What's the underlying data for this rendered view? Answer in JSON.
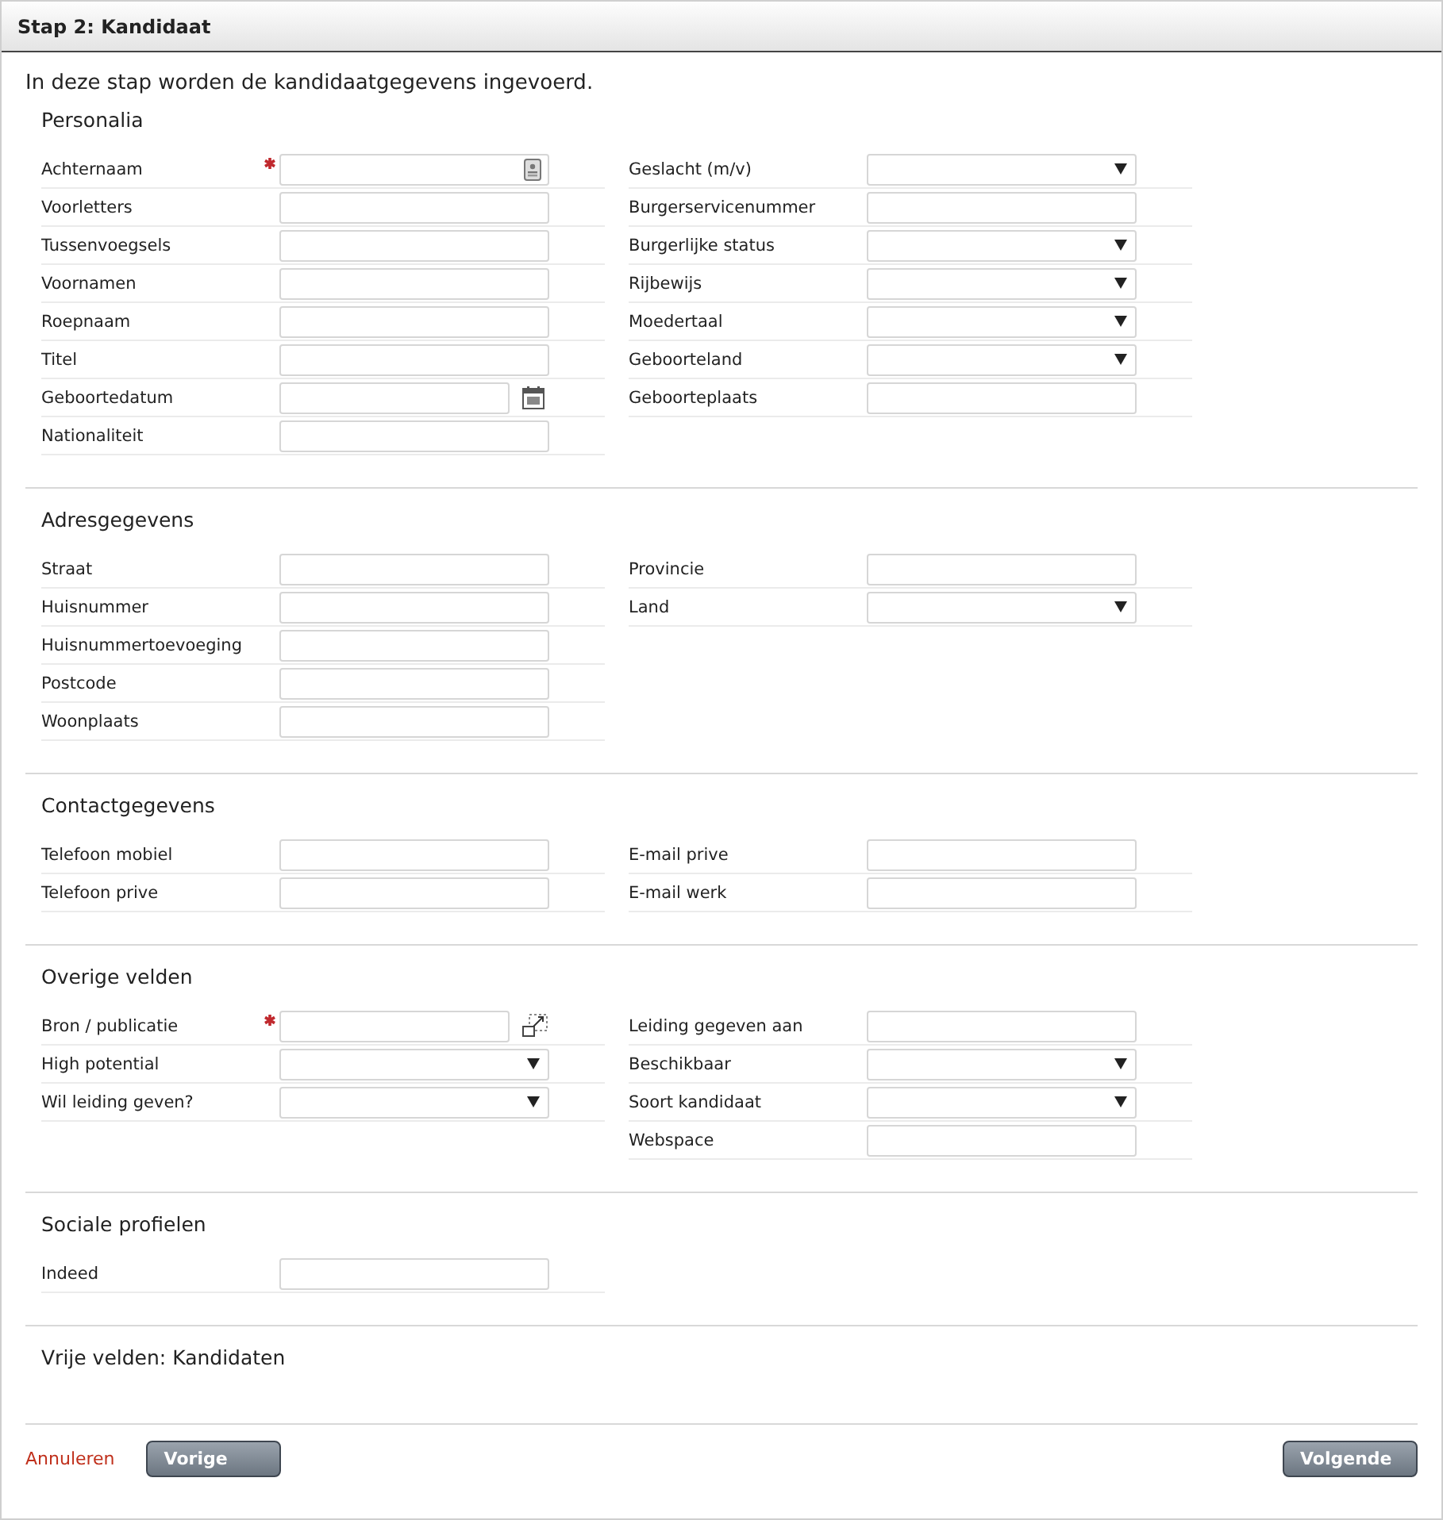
{
  "header": {
    "title": "Stap 2: Kandidaat"
  },
  "intro": "In deze stap worden de kandidaatgegevens ingevoerd.",
  "sections": [
    {
      "title": "Personalia",
      "left": [
        {
          "label": "Achternaam",
          "kind": "lookup",
          "required": true
        },
        {
          "label": "Voorletters",
          "kind": "text",
          "required": false
        },
        {
          "label": "Tussenvoegsels",
          "kind": "text",
          "required": false
        },
        {
          "label": "Voornamen",
          "kind": "text",
          "required": false
        },
        {
          "label": "Roepnaam",
          "kind": "text",
          "required": false
        },
        {
          "label": "Titel",
          "kind": "text",
          "required": false
        },
        {
          "label": "Geboortedatum",
          "kind": "date",
          "required": false
        },
        {
          "label": "Nationaliteit",
          "kind": "text",
          "required": false
        }
      ],
      "right": [
        {
          "label": "Geslacht (m/v)",
          "kind": "select",
          "required": false
        },
        {
          "label": "Burgerservicenummer",
          "kind": "text",
          "required": false
        },
        {
          "label": "Burgerlijke status",
          "kind": "select",
          "required": false
        },
        {
          "label": "Rijbewijs",
          "kind": "select",
          "required": false
        },
        {
          "label": "Moedertaal",
          "kind": "select",
          "required": false
        },
        {
          "label": "Geboorteland",
          "kind": "select",
          "required": false
        },
        {
          "label": "Geboorteplaats",
          "kind": "text",
          "required": false
        }
      ]
    },
    {
      "title": "Adresgegevens",
      "left": [
        {
          "label": "Straat",
          "kind": "text",
          "required": false
        },
        {
          "label": "Huisnummer",
          "kind": "text",
          "required": false
        },
        {
          "label": "Huisnummertoevoeging",
          "kind": "text",
          "required": false
        },
        {
          "label": "Postcode",
          "kind": "text",
          "required": false
        },
        {
          "label": "Woonplaats",
          "kind": "text",
          "required": false
        }
      ],
      "right": [
        {
          "label": "Provincie",
          "kind": "text",
          "required": false
        },
        {
          "label": "Land",
          "kind": "select",
          "required": false
        }
      ]
    },
    {
      "title": "Contactgegevens",
      "left": [
        {
          "label": "Telefoon mobiel",
          "kind": "text",
          "required": false
        },
        {
          "label": "Telefoon prive",
          "kind": "text",
          "required": false
        }
      ],
      "right": [
        {
          "label": "E-mail prive",
          "kind": "text",
          "required": false
        },
        {
          "label": "E-mail werk",
          "kind": "text",
          "required": false
        }
      ]
    },
    {
      "title": "Overige velden",
      "left": [
        {
          "label": "Bron / publicatie",
          "kind": "popup",
          "required": true
        },
        {
          "label": "High potential",
          "kind": "select",
          "required": false
        },
        {
          "label": "Wil leiding geven?",
          "kind": "select",
          "required": false
        }
      ],
      "right": [
        {
          "label": "Leiding gegeven aan",
          "kind": "text",
          "required": false
        },
        {
          "label": "Beschikbaar",
          "kind": "select",
          "required": false
        },
        {
          "label": "Soort kandidaat",
          "kind": "select",
          "required": false
        },
        {
          "label": "Webspace",
          "kind": "text",
          "required": false
        }
      ]
    },
    {
      "title": "Sociale profielen",
      "left": [
        {
          "label": "Indeed",
          "kind": "text",
          "required": false
        }
      ]
    },
    {
      "title": "Vrije velden: Kandidaten"
    }
  ],
  "footer": {
    "cancel": "Annuleren",
    "previous": "Vorige",
    "next": "Volgende"
  }
}
